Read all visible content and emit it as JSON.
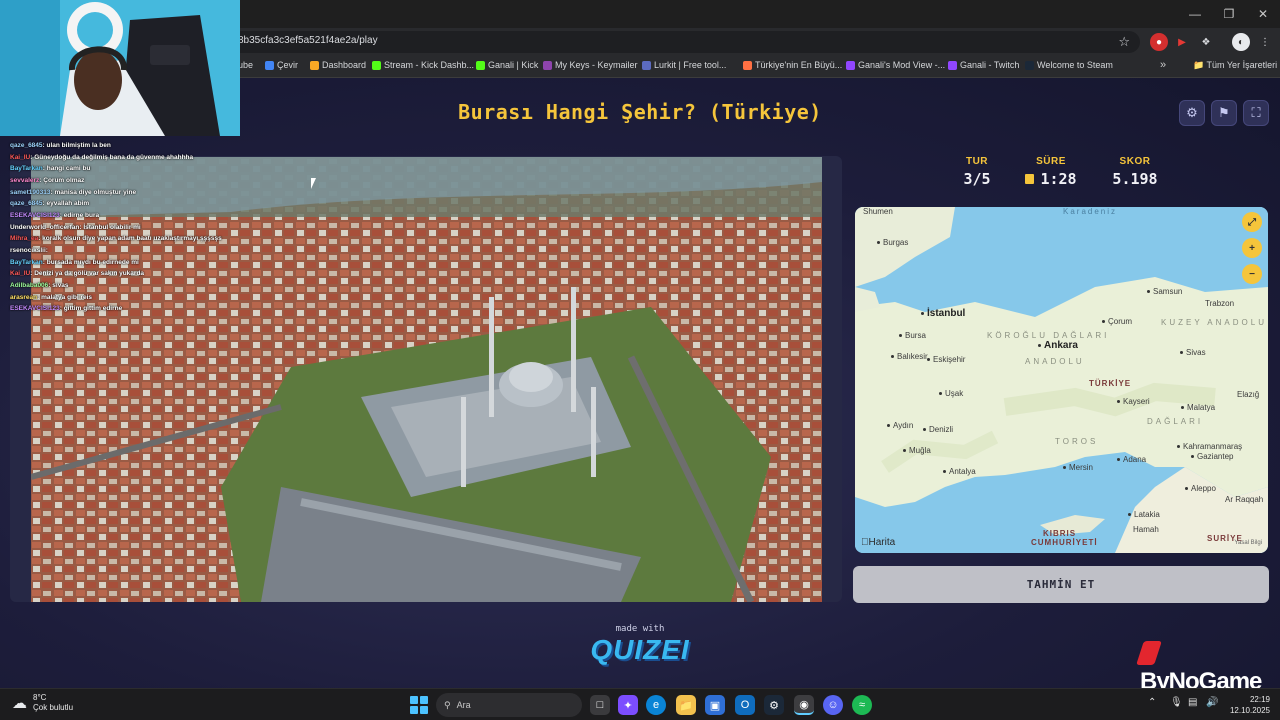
{
  "browser": {
    "url": "8b35cfa3c3ef5a521f4ae2a/play",
    "bookmarks": [
      "ube",
      "Çevir",
      "Dashboard",
      "Stream - Kick Dashb...",
      "Ganali | Kick",
      "My Keys - Keymailer",
      "Lurkit | Free tool...",
      "Türkiye'nin En Büyü...",
      "Ganali's Mod View -...",
      "Ganali - Twitch",
      "Welcome to Steam"
    ],
    "bookmarks_more": "»",
    "all_bookmarks": "Tüm Yer İşaretleri"
  },
  "game": {
    "title": "Burası Hangi Şehir? (Türkiye)",
    "stats": {
      "round_label": "TUR",
      "round_value": "3/5",
      "time_label": "SÜRE",
      "time_value": "1:28",
      "score_label": "SKOR",
      "score_value": "5.198"
    },
    "guess_button": "TAHMİN ET",
    "made_with": "made with",
    "brand": "QUIZEI",
    "sponsor": "ByNoGame"
  },
  "map": {
    "attribution": "Harita",
    "legal": "Yasal Bilgi",
    "sea_labels": [
      "Karadeniz"
    ],
    "region_labels": [
      "KÖROĞLU DAĞLARI",
      "KUZEY ANADOLU",
      "ANADOLU",
      "TOROS",
      "DAĞLARI"
    ],
    "country_labels": [
      "TÜRKİYE",
      "KIBRIS",
      "CUMHURİYETİ",
      "SURİYE"
    ],
    "big_cities": [
      "İstanbul",
      "Ankara"
    ],
    "cities": [
      "Shumen",
      "Burgas",
      "Samsun",
      "Trabzon",
      "Bursa",
      "Çorum",
      "Balıkesir",
      "Eskişehir",
      "Sivas",
      "Uşak",
      "Kayseri",
      "Malatya",
      "Elazığ",
      "Aydın",
      "Denizli",
      "Kahramanmaraş",
      "Muğla",
      "Gaziantep",
      "Antalya",
      "Mersin",
      "Adana",
      "Aleppo",
      "Ar Raqqah",
      "Latakia",
      "Hamah"
    ]
  },
  "chat": [
    {
      "user": "qaze_6845",
      "msg": ": ulan bilmiştim la ben",
      "color": "#9fd5ff"
    },
    {
      "user": "Kai_IU",
      "msg": ": Güneydoğu da değilmiş bana da güvenme ahahhha",
      "color": "#ff5a5a"
    },
    {
      "user": "BayTarkan",
      "msg": ": hangi cami bu",
      "color": "#67d3ff"
    },
    {
      "user": "sevvalerz",
      "msg": ": Çorum olmaz",
      "color": "#ff8ad0"
    },
    {
      "user": "samet190313",
      "msg": ": manisa diye olmuştur yine",
      "color": "#9fd5ff"
    },
    {
      "user": "qaze_6845",
      "msg": ": eyvallah abim",
      "color": "#9fd5ff"
    },
    {
      "user": "ESEKAVCISI123",
      "msg": ": edirne bura",
      "color": "#c58cff"
    },
    {
      "user": "Underworld_officerfan",
      "msg": ": İstanbul olabilir mi",
      "color": "#ffffff"
    },
    {
      "user": "Mihra_ea",
      "msg": ": koralk olsun diye yapan adam baatı uzaklaştırmayı şşşsşs",
      "color": "#ff5a5a"
    },
    {
      "user": "rsenocikslii",
      "msg": ":",
      "color": "#ffffff"
    },
    {
      "user": "BayTarkan",
      "msg": ": bursada mıydı bu edirnede mi",
      "color": "#67d3ff"
    },
    {
      "user": "Kai_IU",
      "msg": ": Denizi ya da gölü var sakın yukarda",
      "color": "#ff5a5a"
    },
    {
      "user": "Adilbaba006",
      "msg": ": sivas",
      "color": "#9fff9f"
    },
    {
      "user": "arasrean",
      "msg": ": malatya gibi reis",
      "color": "#ffe066"
    },
    {
      "user": "ESEKAVCISI123",
      "msg": ": gittim gittim edirne",
      "color": "#c58cff"
    }
  ],
  "taskbar": {
    "weather_temp": "8°C",
    "weather_desc": "Çok bulutlu",
    "search_placeholder": "Ara",
    "time": "22:19",
    "date": "12.10.2025"
  },
  "icons": {
    "close": "close-icon",
    "maximize": "maximize-icon",
    "minimize": "minimize-icon",
    "settings": "gear-icon",
    "report": "flag-icon",
    "fullscreen": "fullscreen-icon",
    "map_expand": "expand-icon",
    "zoom_in": "zoom-in-icon",
    "zoom_out": "zoom-out-icon"
  },
  "colors": {
    "accent_yellow": "#f5c53b",
    "page_bg": "#1d1d3b",
    "button_bg": "#bfc0c7",
    "brand_blue": "#39b8f0",
    "sponsor_red": "#e3262e"
  }
}
